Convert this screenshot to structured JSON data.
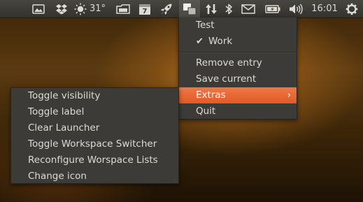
{
  "panel": {
    "indicators": [
      {
        "icon": "desktop-icon"
      },
      {
        "icon": "dropbox-icon"
      },
      {
        "icon": "weather-sun-icon"
      },
      {
        "icon": "storage-icon"
      },
      {
        "icon": "calendar-icon",
        "day": "7"
      },
      {
        "icon": "rocket-icon"
      },
      {
        "icon": "workspace-switcher-icon"
      },
      {
        "icon": "network-updown-icon"
      },
      {
        "icon": "bluetooth-icon"
      },
      {
        "icon": "mail-icon"
      },
      {
        "icon": "battery-icon"
      },
      {
        "icon": "volume-icon"
      },
      {
        "icon": "gear-icon"
      }
    ],
    "temperature": "31°",
    "clock": "16:01"
  },
  "main_menu": {
    "items": [
      {
        "label": "Test"
      },
      {
        "label": "Work",
        "checked": true,
        "check_glyph": "✔"
      },
      {
        "label": "Remove entry"
      },
      {
        "label": "Save current"
      },
      {
        "label": "Extras",
        "highlighted": true,
        "submenu_glyph": "›"
      },
      {
        "label": "Quit"
      }
    ]
  },
  "submenu": {
    "items": [
      {
        "label": "Toggle visibility"
      },
      {
        "label": "Toggle label"
      },
      {
        "label": "Clear Launcher"
      },
      {
        "label": "Toggle Workspace Switcher"
      },
      {
        "label": "Reconfigure Worspace Lists"
      },
      {
        "label": "Change icon"
      }
    ]
  },
  "colors": {
    "panel_bg": "#3c3b37",
    "menu_bg": "#3c3b37",
    "menu_text": "#dfdbd2",
    "highlight": "#e9642f"
  }
}
